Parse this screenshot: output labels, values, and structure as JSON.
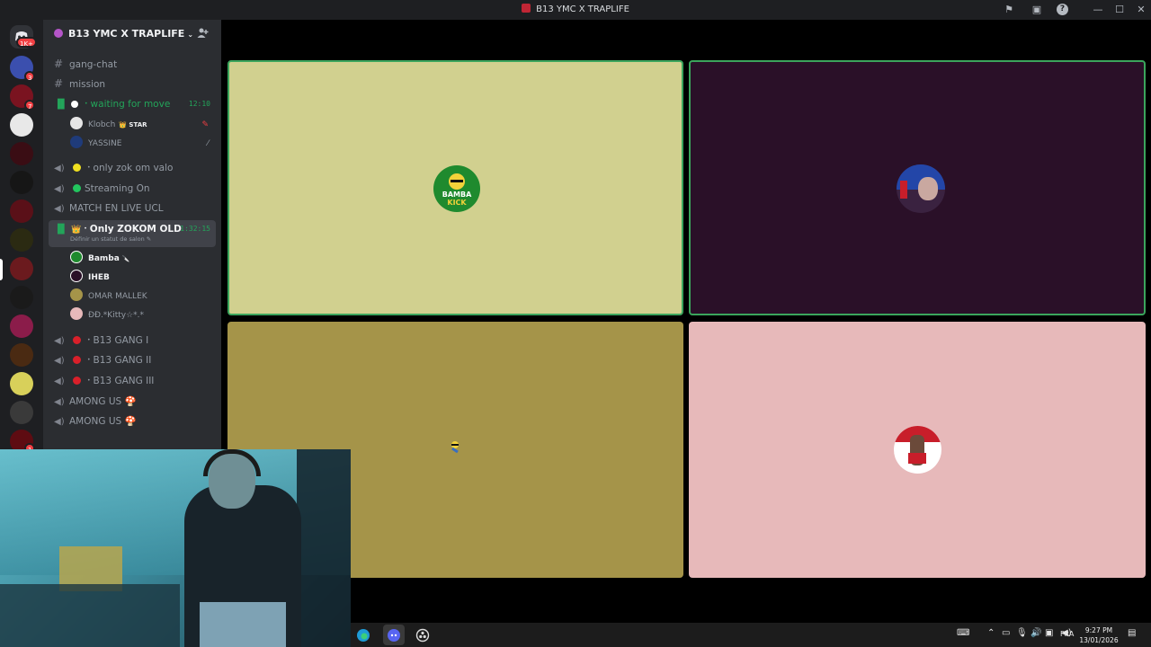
{
  "window": {
    "title": "B13 YMC X TRAPLIFE"
  },
  "titlebar": {
    "icons": [
      "flag-icon",
      "screen-share-icon",
      "help-icon",
      "minimize-icon",
      "maximize-icon",
      "close-icon"
    ],
    "help_glyph": "?",
    "minimize_glyph": "—",
    "maximize_glyph": "☐",
    "close_glyph": "✕"
  },
  "rail": {
    "home_badge": "1K+",
    "badges": {
      "s1": "3",
      "s2": "7",
      "s13": "1"
    }
  },
  "server": {
    "name": "B13 YMC X TRAPLIFE",
    "chevron": "⌄"
  },
  "channels": {
    "text": [
      {
        "name": "gang-chat"
      },
      {
        "name": "mission"
      }
    ],
    "voice": {
      "waiting": {
        "name": "waiting for move",
        "time": "12:10",
        "members": [
          {
            "name": "Klobch",
            "badge": "👑 STAR"
          },
          {
            "name": "YASSINE"
          }
        ]
      },
      "valo": {
        "name": "only zok om valo",
        "dot_color": "#f0e020"
      },
      "streaming": {
        "name": "Streaming On",
        "dot_color": "#22c55e"
      },
      "match": {
        "name": "MATCH EN LIVE UCL"
      },
      "zokom": {
        "name": "Only ZOKOM OLD",
        "time": "1:32:15",
        "status_hint": "Définir un statut de salon ✎",
        "members": [
          {
            "name": "Bamba",
            "suffix": "🔪"
          },
          {
            "name": "IHEB"
          },
          {
            "name": "OMAR MALLEK"
          },
          {
            "name": "ÐÐ.*Kitty☆*.*"
          }
        ]
      },
      "gang1": {
        "name": "B13 GANG I",
        "dot_color": "#d9202a"
      },
      "gang2": {
        "name": "B13 GANG II",
        "dot_color": "#d9202a"
      },
      "gang3": {
        "name": "B13 GANG III",
        "dot_color": "#d9202a"
      },
      "among1": {
        "name": "AMONG US 🍄"
      },
      "among2": {
        "name": "AMONG US 🍄"
      }
    }
  },
  "video_grid": {
    "tiles": [
      {
        "bg": "#d1d08f",
        "speaking": true,
        "avatar_label": "BAMBA KICK"
      },
      {
        "bg": "#2a1028",
        "speaking": true
      },
      {
        "bg": "#a59449",
        "speaking": false
      },
      {
        "bg": "#e7b9ba",
        "speaking": false
      }
    ]
  },
  "taskbar": {
    "language": "FRA",
    "time": "9:27 PM",
    "date": "13/01/2026",
    "apps": [
      "edge-icon",
      "discord-icon",
      "obs-icon"
    ]
  }
}
